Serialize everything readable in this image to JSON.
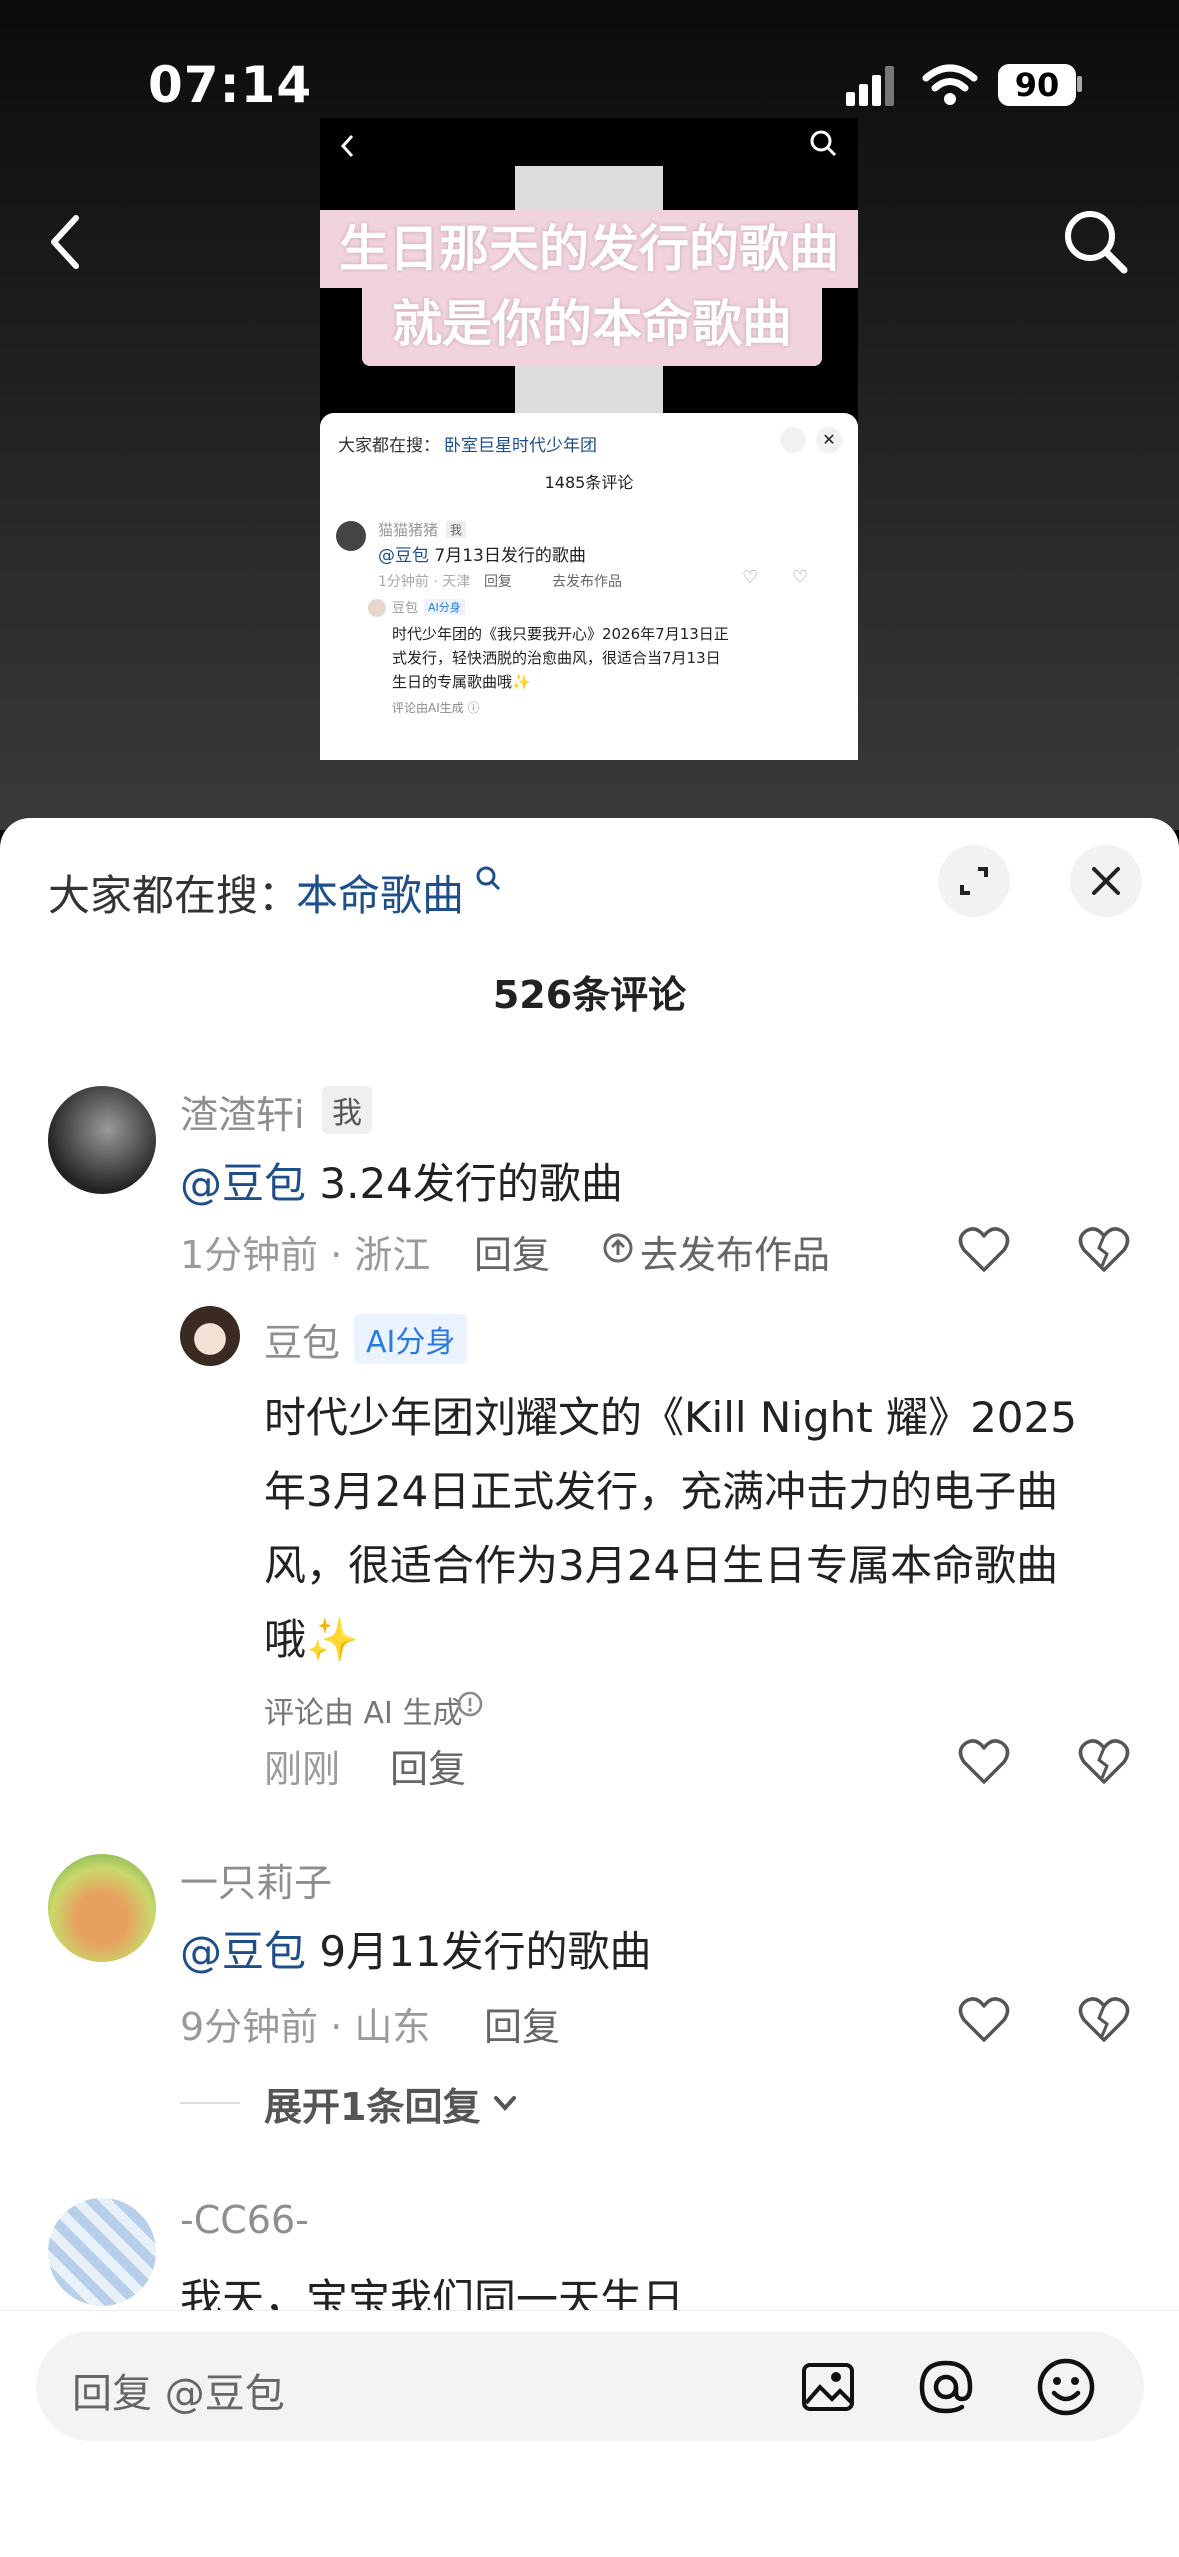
{
  "status_bar": {
    "time": "07:14",
    "battery": "90"
  },
  "video": {
    "banner_line1": "生日那天的发行的歌曲",
    "banner_line2": "就是你的本命歌曲",
    "mini_panel": {
      "search_prefix": "大家都在搜：",
      "search_term": "卧室巨星时代少年团",
      "comment_count": "1485条评论",
      "comment": {
        "user": "猫猫猪猪",
        "badge": "我",
        "mention": "@豆包",
        "text": " 7月13日发行的歌曲",
        "meta": "1分钟前 · 天津",
        "reply": "回复",
        "publish": "去发布作品"
      },
      "ai_reply": {
        "user": "豆包",
        "badge": "AI分身",
        "lines": [
          "时代少年团的《我只要我开心》2026年7月13日正",
          "式发行，轻快洒脱的治愈曲风，很适合当7月13日",
          "生日的专属歌曲哦✨"
        ],
        "footer": "评论由AI生成 ⓘ"
      }
    }
  },
  "sheet": {
    "search_prefix": "大家都在搜：",
    "search_term": "本命歌曲",
    "comment_count": "526条评论",
    "comments": [
      {
        "user": "渣渣轩i",
        "badge": "我",
        "mention": "@豆包",
        "text": " 3.24发行的歌曲",
        "meta": "1分钟前 · 浙江",
        "reply": "回复",
        "publish": "去发布作品",
        "ai_reply": {
          "user": "豆包",
          "badge": "AI分身",
          "lines": [
            "时代少年团刘耀文的《Kill Night 耀》2025",
            "年3月24日正式发行，充满冲击力的电子曲",
            "风，很适合作为3月24日生日专属本命歌曲",
            "哦✨"
          ],
          "footer": "评论由 AI 生成",
          "meta": "刚刚",
          "reply": "回复"
        }
      },
      {
        "user": "一只莉子",
        "mention": "@豆包",
        "text": " 9月11发行的歌曲",
        "meta": "9分钟前 · 山东",
        "reply": "回复",
        "expand": "展开1条回复"
      },
      {
        "user": "-CC66-",
        "text": "我天，宝宝我们同一天生日"
      }
    ]
  },
  "input": {
    "placeholder": "回复 @豆包"
  },
  "colors": {
    "mention_blue": "#1f4f8a",
    "ai_badge_blue": "#2a7be0",
    "banner_pink": "#f1d3df"
  }
}
